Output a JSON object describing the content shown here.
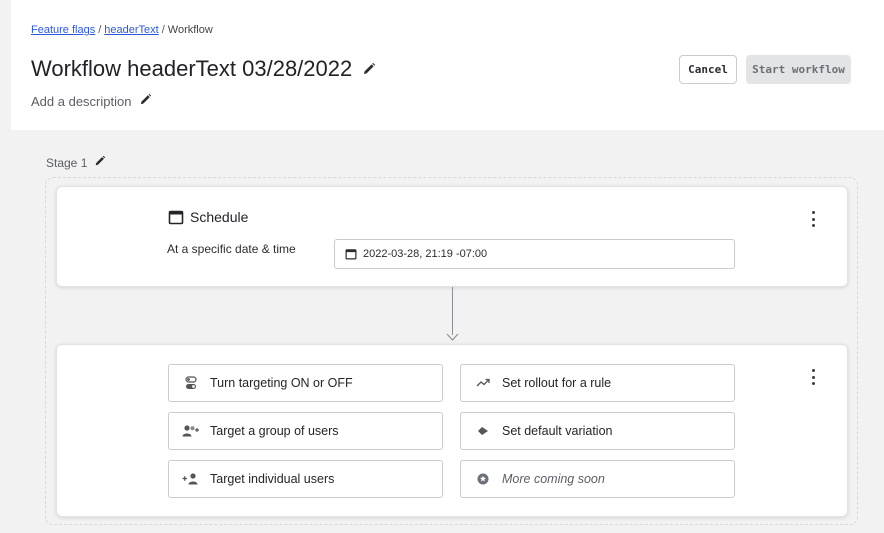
{
  "breadcrumb": {
    "items": [
      "Feature flags",
      "headerText",
      "Workflow"
    ],
    "separator": "/"
  },
  "page": {
    "title": "Workflow headerText 03/28/2022",
    "description_placeholder": "Add a description"
  },
  "buttons": {
    "cancel": "Cancel",
    "start": "Start workflow"
  },
  "stage": {
    "label": "Stage 1"
  },
  "schedule": {
    "title": "Schedule",
    "row_label": "At a specific date & time",
    "datetime": "2022-03-28, 21:19 -07:00"
  },
  "actions": [
    {
      "label": "Turn targeting ON or OFF",
      "icon": "toggle-icon"
    },
    {
      "label": "Set rollout for a rule",
      "icon": "trend-icon"
    },
    {
      "label": "Target a group of users",
      "icon": "users-group-icon"
    },
    {
      "label": "Set default variation",
      "icon": "diamond-icon"
    },
    {
      "label": "Target individual users",
      "icon": "add-user-icon"
    },
    {
      "label": "More coming soon",
      "icon": "star-badge-icon"
    }
  ],
  "colors": {
    "link": "#2b59d9",
    "text": "#23252a",
    "muted": "#5b5e66",
    "border": "#c9cbd0",
    "disabled_button_bg": "#e3e4e6"
  }
}
